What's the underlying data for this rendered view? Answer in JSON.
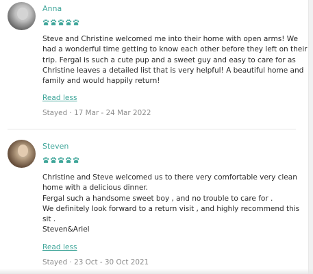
{
  "reviews": [
    {
      "name": "Anna",
      "rating_paws": 5,
      "body_lines": [
        "Steve and Christine welcomed me into their home with open arms! We",
        "had a wonderful time getting to know each other before they left on their",
        "trip. Fergal is such a cute pup and a sweet guy and easy to care for as",
        "Christine leaves a detailed list that is very helpful! A beautiful home and",
        "family and would happily return!"
      ],
      "read_less": "Read less",
      "stay": "Stayed · 17 Mar - 24 Mar 2022"
    },
    {
      "name": "Steven",
      "rating_paws": 5,
      "body_lines": [
        "Christine and Steve welcomed us to there very comfortable very clean",
        "home with a delicious dinner.",
        "Fergal such a handsome sweet boy , and no trouble to care for .",
        "We definitely look forward to a return visit , and highly recommend this",
        "sit .",
        "Steven&Ariel"
      ],
      "read_less": "Read less",
      "stay": "Stayed · 23 Oct - 30 Oct 2021"
    }
  ],
  "colors": {
    "accent": "#3ea599",
    "text": "#2b2b2b",
    "muted": "#8c8c8c",
    "divider": "#e6e6e6"
  },
  "icons": {
    "rating": "paw-icon"
  }
}
